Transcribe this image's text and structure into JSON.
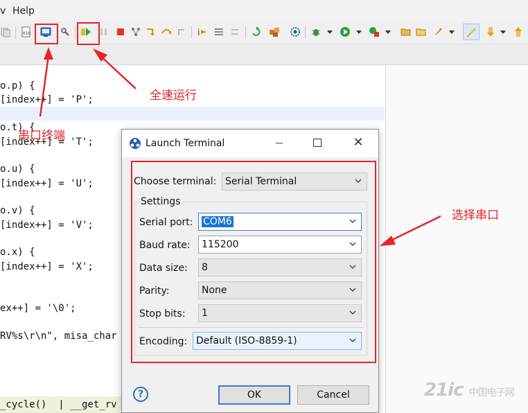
{
  "menubar": {
    "partial": "v",
    "help": "Help"
  },
  "code": [
    {
      "text": "o.p) {"
    },
    {
      "text": "[index++] = 'P';"
    },
    {
      "text": "o.t) {"
    },
    {
      "text": "[index++] = 'T';"
    },
    {
      "text": "o.u) {"
    },
    {
      "text": "[index++] = 'U';"
    },
    {
      "text": "o.v) {"
    },
    {
      "text": "[index++] = 'V';"
    },
    {
      "text": "o.x) {"
    },
    {
      "text": "[index++] = 'X';"
    },
    {
      "text": "ex++] = '\\0';"
    },
    {
      "text": "RV%s\\r\\n\", misa_char"
    },
    {
      "text": "_cycle()  | __get_rv"
    }
  ],
  "dialog": {
    "title": "Launch Terminal",
    "choose_label": "Choose terminal:",
    "choose_value": "Serial Terminal",
    "settings_label": "Settings",
    "serial_port_label": "Serial port:",
    "serial_port_value": "COM6",
    "baud_label": "Baud rate:",
    "baud_value": "115200",
    "data_size_label": "Data size:",
    "data_size_value": "8",
    "parity_label": "Parity:",
    "parity_value": "None",
    "stop_bits_label": "Stop bits:",
    "stop_bits_value": "1",
    "encoding_label": "Encoding:",
    "encoding_value": "Default (ISO-8859-1)",
    "ok": "OK",
    "cancel": "Cancel",
    "help": "?"
  },
  "annotations": {
    "serial_terminal": "串口终端",
    "full_speed_run": "全速运行",
    "select_serial": "选择串口"
  },
  "watermark": {
    "main": "21ic",
    "sub": "中国电子网"
  },
  "colors": {
    "annotation": "#e8222a",
    "selection": "#1b72d6",
    "accent": "#3b7ad3"
  }
}
